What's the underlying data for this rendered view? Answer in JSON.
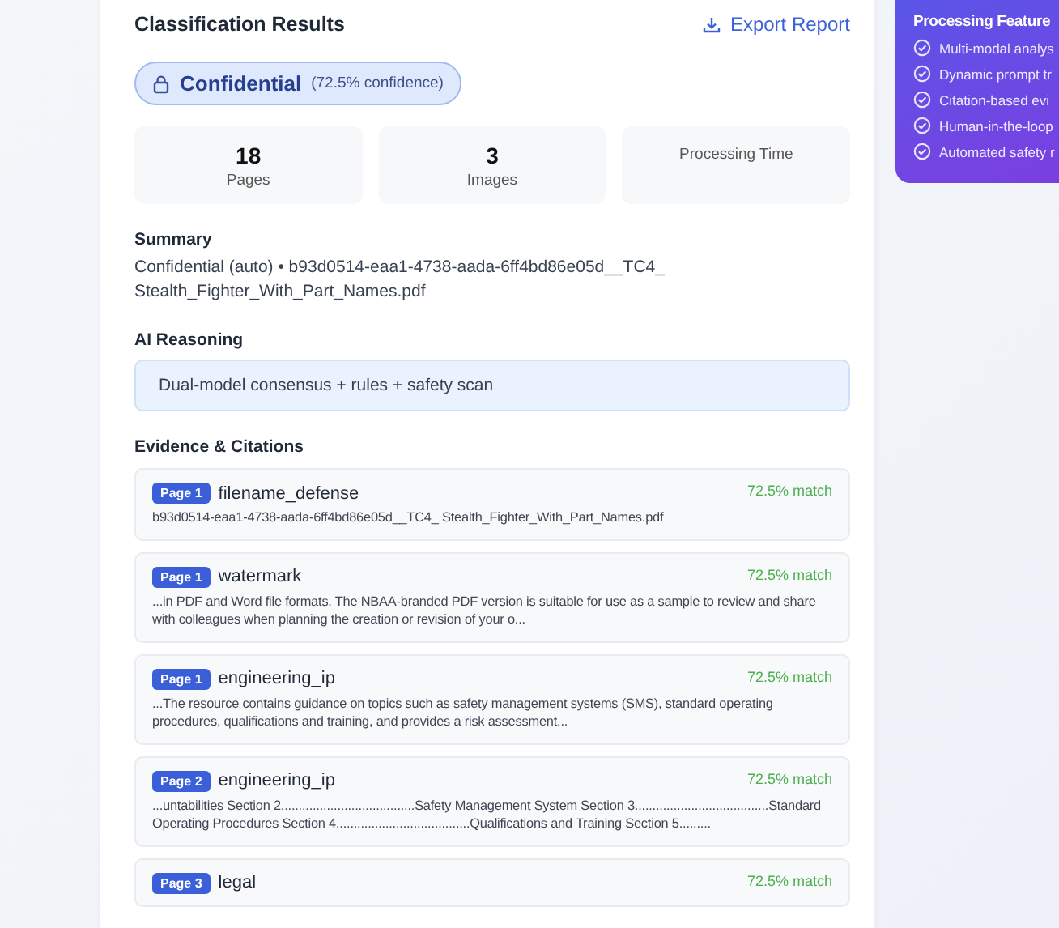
{
  "results": {
    "title": "Classification Results",
    "export_button": "Export Report",
    "classification": {
      "label": "Confidential",
      "confidence": "(72.5% confidence)"
    },
    "stats": [
      {
        "value": "18",
        "label": "Pages"
      },
      {
        "value": "3",
        "label": "Images"
      },
      {
        "label": "Processing Time"
      }
    ],
    "summary": {
      "heading": "Summary",
      "text": "Confidential (auto) • b93d0514-eaa1-4738-aada-6ff4bd86e05d__TC4_ Stealth_Fighter_With_Part_Names.pdf"
    },
    "reasoning": {
      "heading": "AI Reasoning",
      "text": "Dual-model consensus + rules + safety scan"
    },
    "evidence": {
      "heading": "Evidence & Citations",
      "items": [
        {
          "page": "Page 1",
          "category": "filename_defense",
          "match": "72.5% match",
          "excerpt": "b93d0514-eaa1-4738-aada-6ff4bd86e05d__TC4_ Stealth_Fighter_With_Part_Names.pdf"
        },
        {
          "page": "Page 1",
          "category": "watermark",
          "match": "72.5% match",
          "excerpt": "...in PDF and Word file formats. The NBAA-branded PDF version is suitable for use as a sample to review and share with colleagues when planning the creation or revision of your o..."
        },
        {
          "page": "Page 1",
          "category": "engineering_ip",
          "match": "72.5% match",
          "excerpt": "...The resource contains guidance on topics such as safety management systems (SMS), standard operating procedures, qualifications and training, and provides a risk assessment..."
        },
        {
          "page": "Page 2",
          "category": "engineering_ip",
          "match": "72.5% match",
          "excerpt": "...untabilities Section 2......................................Safety Management System Section 3......................................Standard Operating Procedures Section 4......................................Qualifications and Training Section 5........."
        },
        {
          "page": "Page 3",
          "category": "legal",
          "match": "72.5% match"
        }
      ]
    }
  },
  "features": {
    "title": "Processing Feature",
    "items": [
      "Multi-modal analys",
      "Dynamic prompt tr",
      "Citation-based evi",
      "Human-in-the-loop",
      "Automated safety r"
    ]
  }
}
